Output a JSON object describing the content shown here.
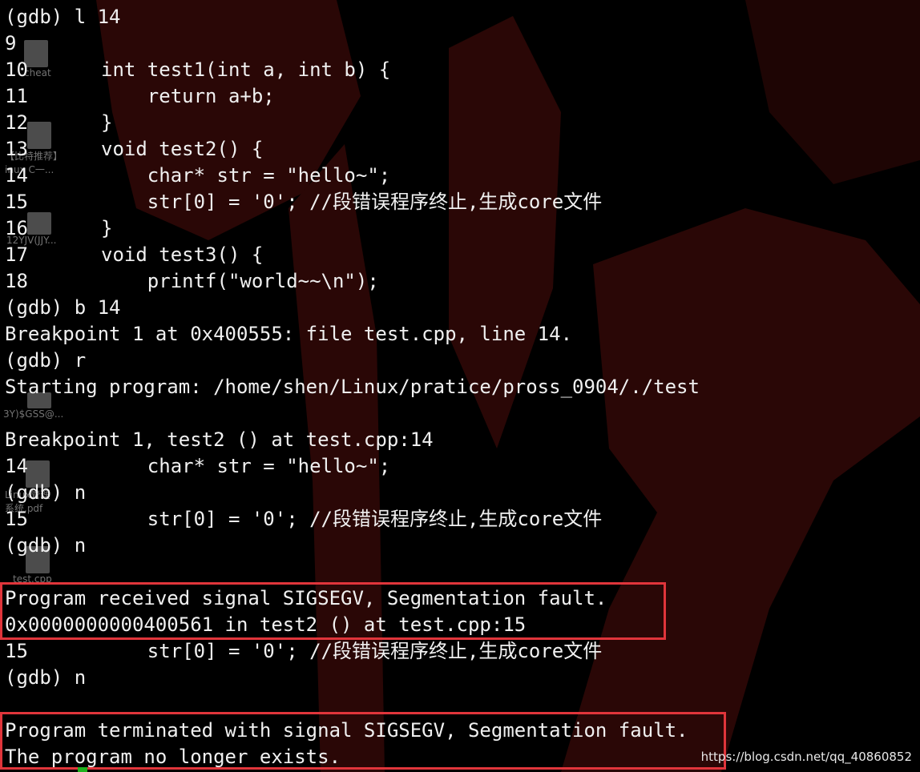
{
  "terminal": {
    "lines": [
      {
        "text": "(gdb) l 14"
      },
      {
        "num": "9",
        "code": ""
      },
      {
        "num": "10",
        "code": "int test1(int a, int b) {"
      },
      {
        "num": "11",
        "code": "    return a+b;"
      },
      {
        "num": "12",
        "code": "}"
      },
      {
        "num": "13",
        "code": "void test2() {"
      },
      {
        "num": "14",
        "code": "    char* str = \"hello~\";"
      },
      {
        "num": "15",
        "code": "    str[0] = '0'; //段错误程序终止,生成core文件"
      },
      {
        "num": "16",
        "code": "}"
      },
      {
        "num": "17",
        "code": "void test3() {"
      },
      {
        "num": "18",
        "code": "    printf(\"world~~\\n\");"
      },
      {
        "text": "(gdb) b 14"
      },
      {
        "text": "Breakpoint 1 at 0x400555: file test.cpp, line 14."
      },
      {
        "text": "(gdb) r"
      },
      {
        "text": "Starting program: /home/shen/Linux/pratice/pross_0904/./test"
      },
      {
        "text": ""
      },
      {
        "text": "Breakpoint 1, test2 () at test.cpp:14"
      },
      {
        "num": "14",
        "code": "    char* str = \"hello~\";"
      },
      {
        "text": "(gdb) n"
      },
      {
        "num": "15",
        "code": "    str[0] = '0'; //段错误程序终止,生成core文件"
      },
      {
        "text": "(gdb) n"
      },
      {
        "text": ""
      },
      {
        "text": "Program received signal SIGSEGV, Segmentation fault."
      },
      {
        "text": "0x0000000000400561 in test2 () at test.cpp:15"
      },
      {
        "num": "15",
        "code": "    str[0] = '0'; //段错误程序终止,生成core文件"
      },
      {
        "text": "(gdb) n"
      },
      {
        "text": ""
      },
      {
        "text": "Program terminated with signal SIGSEGV, Segmentation fault."
      },
      {
        "text": "The program no longer exists."
      }
    ]
  },
  "desktop_icons": [
    {
      "label": "cheat",
      "icon": "folder-icon"
    },
    {
      "label": "【比特推荐】",
      "icon": "pdf-icon"
    },
    {
      "label": "inux C一...",
      "icon": "pdf-icon"
    },
    {
      "label": "12YJV(JJY...",
      "icon": "file-icon"
    },
    {
      "label": "3Y)$GSS@...",
      "icon": "image-icon"
    },
    {
      "label": "Linux管理",
      "icon": "pdf-icon"
    },
    {
      "label": "系统.pdf",
      "icon": "pdf-icon"
    },
    {
      "label": "test.cpp",
      "icon": "file-icon"
    }
  ],
  "watermark": "https://blog.csdn.net/qq_40860852",
  "colors": {
    "background": "#000000",
    "wallpaper_red": "#2a0706",
    "text": "#f0f0f0",
    "highlight_border": "#e0353b"
  }
}
